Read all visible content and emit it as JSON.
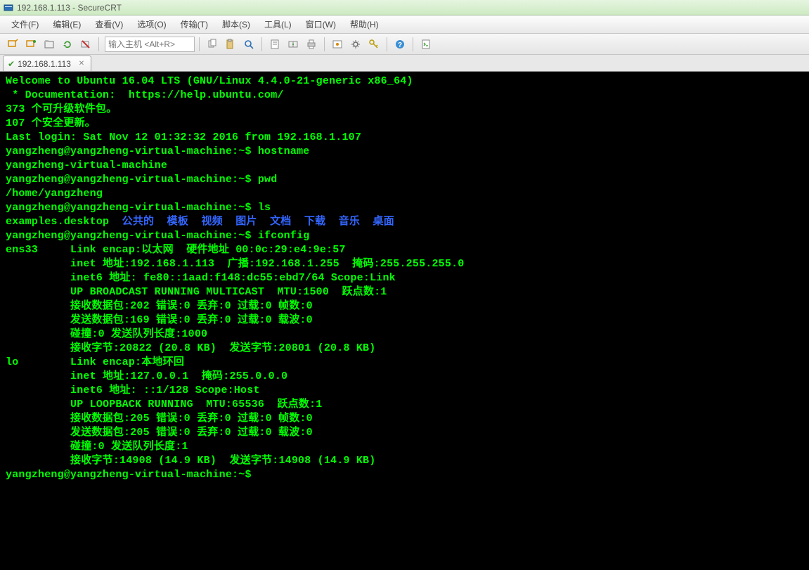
{
  "window": {
    "title": "192.168.1.113 - SecureCRT"
  },
  "menu": {
    "items": [
      "文件(F)",
      "编辑(E)",
      "查看(V)",
      "选项(O)",
      "传输(T)",
      "脚本(S)",
      "工具(L)",
      "窗口(W)",
      "帮助(H)"
    ]
  },
  "toolbar": {
    "host_placeholder": "输入主机 <Alt+R>"
  },
  "tab": {
    "label": "192.168.1.113"
  },
  "term": {
    "banner1": "Welcome to Ubuntu 16.04 LTS (GNU/Linux 4.4.0-21-generic x86_64)",
    "blank": "",
    "doc": " * Documentation:  https://help.ubuntu.com/",
    "upgradable": "373 个可升级软件包。",
    "security": "107 个安全更新。",
    "lastlogin": "Last login: Sat Nov 12 01:32:32 2016 from 192.168.1.107",
    "prompt": "yangzheng@yangzheng-virtual-machine:~$ ",
    "cmd_hostname": "hostname",
    "out_hostname": "yangzheng-virtual-machine",
    "cmd_pwd": "pwd",
    "out_pwd": "/home/yangzheng",
    "cmd_ls": "ls",
    "ls_file": "examples.desktop",
    "ls_dirs": [
      "公共的",
      "模板",
      "视频",
      "图片",
      "文档",
      "下载",
      "音乐",
      "桌面"
    ],
    "cmd_ifconfig": "ifconfig",
    "if_l1": "ens33     Link encap:以太网  硬件地址 00:0c:29:e4:9e:57",
    "if_l2": "          inet 地址:192.168.1.113  广播:192.168.1.255  掩码:255.255.255.0",
    "if_l3": "          inet6 地址: fe80::1aad:f148:dc55:ebd7/64 Scope:Link",
    "if_l4": "          UP BROADCAST RUNNING MULTICAST  MTU:1500  跃点数:1",
    "if_l5": "          接收数据包:202 错误:0 丢弃:0 过载:0 帧数:0",
    "if_l6": "          发送数据包:169 错误:0 丢弃:0 过载:0 载波:0",
    "if_l7": "          碰撞:0 发送队列长度:1000",
    "if_l8": "          接收字节:20822 (20.8 KB)  发送字节:20801 (20.8 KB)",
    "lo_l1": "lo        Link encap:本地环回",
    "lo_l2": "          inet 地址:127.0.0.1  掩码:255.0.0.0",
    "lo_l3": "          inet6 地址: ::1/128 Scope:Host",
    "lo_l4": "          UP LOOPBACK RUNNING  MTU:65536  跃点数:1",
    "lo_l5": "          接收数据包:205 错误:0 丢弃:0 过载:0 帧数:0",
    "lo_l6": "          发送数据包:205 错误:0 丢弃:0 过载:0 载波:0",
    "lo_l7": "          碰撞:0 发送队列长度:1",
    "lo_l8": "          接收字节:14908 (14.9 KB)  发送字节:14908 (14.9 KB)"
  }
}
